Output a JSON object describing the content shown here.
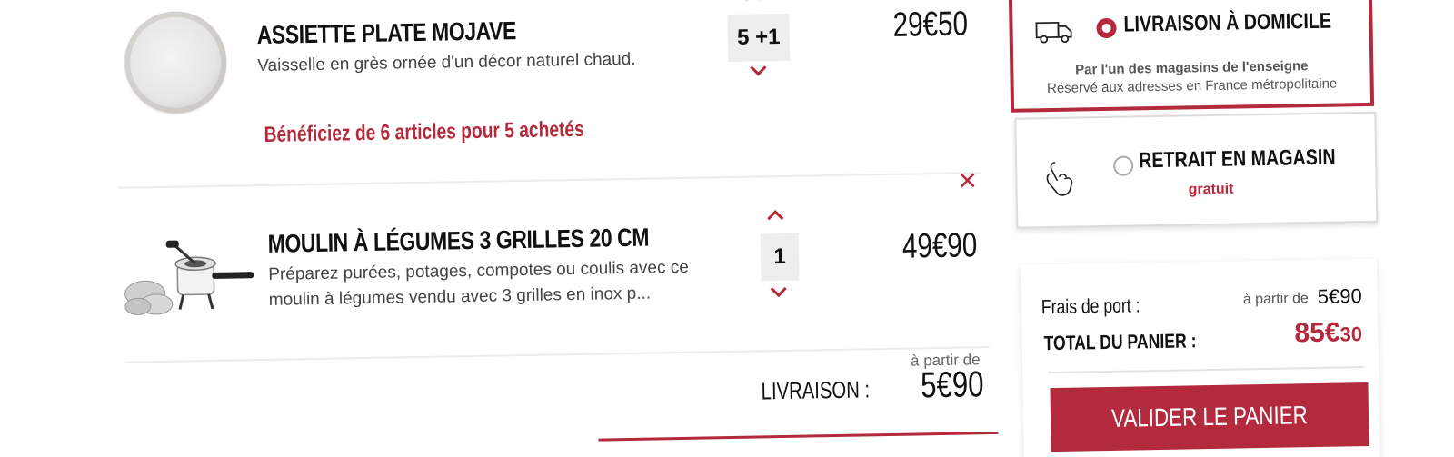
{
  "cart": {
    "items": [
      {
        "name": "ASSIETTE PLATE MOJAVE",
        "description": "Vaisselle en grès ornée d'un décor naturel chaud.",
        "quantity": "5 +1",
        "price": "29€50",
        "promo": "Bénéficiez de 6 articles pour 5 achetés"
      },
      {
        "name": "MOULIN À LÉGUMES 3 GRILLES 20 CM",
        "description_line1": "Préparez purées, potages, compotes ou coulis avec ce",
        "description_line2": "moulin à légumes vendu avec 3 grilles en inox p...",
        "quantity": "1",
        "price": "49€90"
      }
    ],
    "delivery": {
      "label": "LIVRAISON :",
      "from_label": "à partir de",
      "price": "5€90"
    }
  },
  "shipping_options": {
    "home": {
      "title": "LIVRAISON À DOMICILE",
      "subtitle_bold": "Par l'un des magasins de l'enseigne",
      "subtitle": "Réservé aux adresses en France métropolitaine",
      "selected": true
    },
    "store": {
      "title": "RETRAIT EN MAGASIN",
      "price": "gratuit",
      "selected": false
    }
  },
  "summary": {
    "shipping_label": "Frais de port :",
    "shipping_from": "à partir de",
    "shipping_price": "5€90",
    "total_label": "TOTAL DU PANIER :",
    "total_main": "85€",
    "total_cents": "30",
    "validate_label": "VALIDER LE PANIER"
  },
  "colors": {
    "accent": "#b32a3c",
    "divider": "#ececec",
    "qty_bg": "#eeeeee"
  },
  "icons": [
    "chevron-up-icon",
    "chevron-down-icon",
    "close-icon",
    "truck-icon",
    "hand-click-icon"
  ]
}
